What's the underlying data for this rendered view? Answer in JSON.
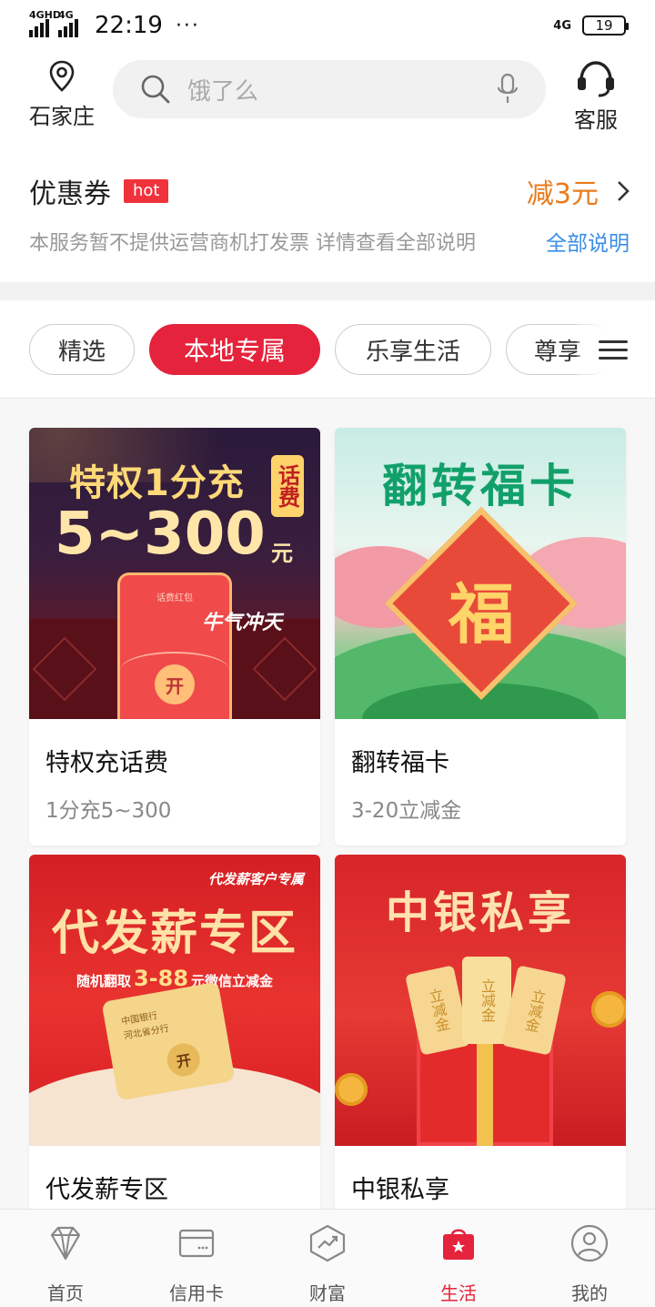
{
  "status_bar": {
    "signal1": "4GHD",
    "signal2": "4G",
    "time": "22:19",
    "dots": "···",
    "network": "4G",
    "battery": "19"
  },
  "header": {
    "location": "石家庄",
    "search_placeholder": "饿了么",
    "service_label": "客服"
  },
  "coupon": {
    "title": "优惠券",
    "badge": "hot",
    "discount": "减3元",
    "notice": "本服务暂不提供运营商机打发票 详情查看全部说明",
    "link": "全部说明"
  },
  "tabs": [
    {
      "label": "精选",
      "active": false
    },
    {
      "label": "本地专属",
      "active": true
    },
    {
      "label": "乐享生活",
      "active": false
    },
    {
      "label": "尊享",
      "active": false
    }
  ],
  "cards": [
    {
      "title": "特权充话费",
      "subtitle": "1分充5~300",
      "image": {
        "line1": "特权1分充",
        "line2": "5~300",
        "unit": "元",
        "side_tag": "话费",
        "envelope_top": "话费红包",
        "envelope_slogan": "牛气冲天",
        "open": "开"
      }
    },
    {
      "title": "翻转福卡",
      "subtitle": "3-20立减金",
      "image": {
        "headline": "翻转福卡",
        "fu": "福"
      }
    },
    {
      "title": "代发薪专区",
      "subtitle": "",
      "image": {
        "tag": "代发薪客户专属",
        "headline": "代发薪专区",
        "promo_pre": "随机翻取",
        "promo_num": "3-88",
        "promo_post": "元微信立减金",
        "card_line1": "中国银行",
        "card_line2": "河北省分行",
        "open": "开"
      }
    },
    {
      "title": "中银私享",
      "subtitle": "",
      "image": {
        "headline": "中银私享",
        "ticket": "立减金"
      }
    }
  ],
  "nav": [
    {
      "label": "首页",
      "icon": "diamond-icon",
      "active": false
    },
    {
      "label": "信用卡",
      "icon": "credit-card-icon",
      "active": false
    },
    {
      "label": "财富",
      "icon": "wealth-chart-icon",
      "active": false
    },
    {
      "label": "生活",
      "icon": "shopping-bag-icon",
      "active": true
    },
    {
      "label": "我的",
      "icon": "user-icon",
      "active": false
    }
  ],
  "colors": {
    "brand_red": "#e5233c",
    "discount_orange": "#e97b1c",
    "link_blue": "#3a8ee6"
  }
}
